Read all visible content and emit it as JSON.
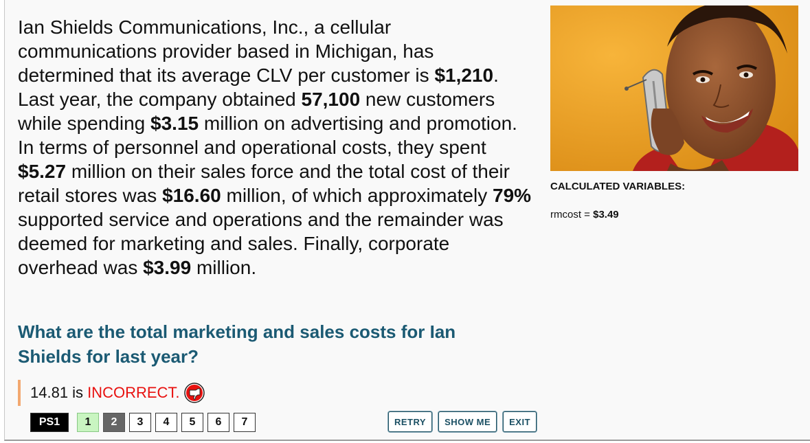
{
  "problem": {
    "p1": "Ian Shields Communications, Inc., a cellular communications provider based in Michigan, has determined that its average CLV per customer is ",
    "clv": "$1,210",
    "p2": ". Last year, the company obtained ",
    "customers": "57,100",
    "p3": " new customers while spending ",
    "advertising": "$3.15",
    "p4": " million on advertising and promotion. In terms of personnel and operational costs, they spent ",
    "sales_force": "$5.27",
    "p5": " million on their sales force and the total cost of their retail stores was ",
    "retail": "$16.60",
    "p6": " million, of which approximately ",
    "percent": "79%",
    "p7": " supported service and operations and the remainder was deemed for marketing and sales. Finally, corporate overhead was ",
    "overhead": "$3.99",
    "p8": " million."
  },
  "question": "What are the total marketing and sales costs for Ian Shields for last year?",
  "feedback": {
    "answer": "14.81 is",
    "status": "INCORRECT.",
    "icon": "thumbs-down-icon",
    "status_color": "#e8110f"
  },
  "pager": {
    "set_label": "PS1",
    "pages": [
      "1",
      "2",
      "3",
      "4",
      "5",
      "6",
      "7"
    ],
    "completed": [
      "1"
    ],
    "current": "2"
  },
  "buttons": {
    "retry": "RETRY",
    "show_me": "SHOW ME",
    "exit": "EXIT"
  },
  "photo": {
    "icon": "woman-on-phone-photo"
  },
  "calculated": {
    "title": "CALCULATED VARIABLES:",
    "var_name": "rmcost",
    "equals": " = ",
    "var_value": "$3.49"
  },
  "colors": {
    "question": "#1b5a73",
    "incorrect": "#e8110f",
    "feedback_bar": "#f2a870",
    "completed_page": "#c9f5c1",
    "current_page": "#666666"
  }
}
